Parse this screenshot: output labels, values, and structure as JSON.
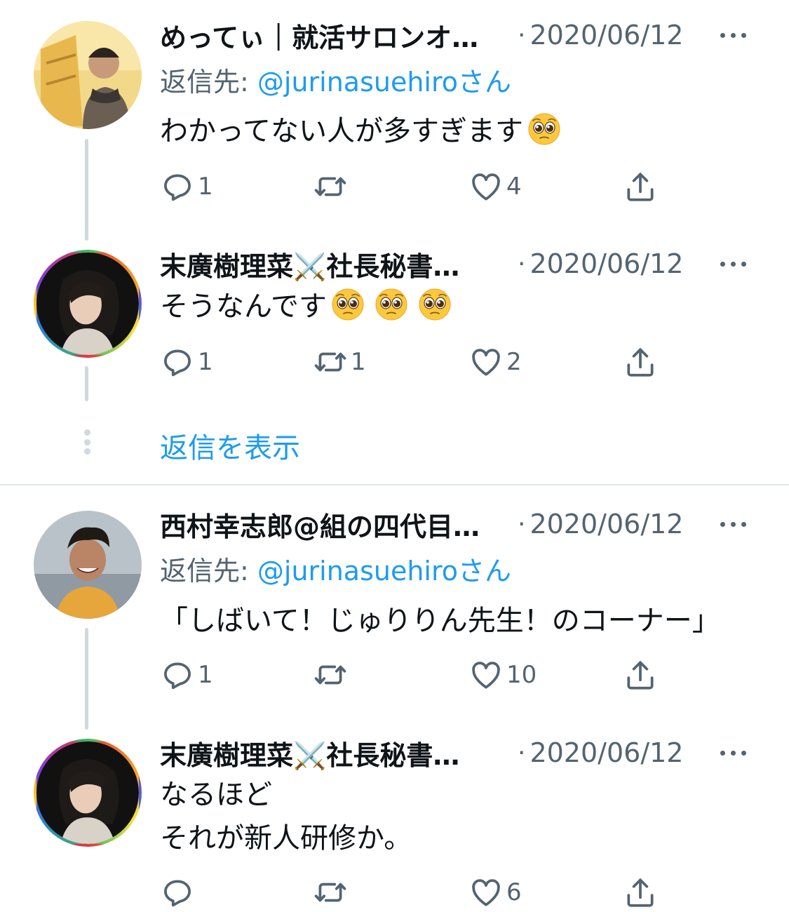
{
  "tweets": [
    {
      "name": "めってぃ｜就活サロンオ…",
      "separator": "·",
      "date": "2020/06/12",
      "reply_prefix": "返信先: ",
      "reply_handle": "@jurinasuehiro",
      "reply_suffix": "さん",
      "text_lines": [
        "わかってない人が多すぎます"
      ],
      "emoji_count": 1,
      "replies": "1",
      "retweets": "",
      "likes": "4"
    },
    {
      "name": "末廣樹理菜⚔️社長秘書…",
      "separator": "·",
      "date": "2020/06/12",
      "text_lines": [
        "そうなんです"
      ],
      "emoji_count": 3,
      "replies": "1",
      "retweets": "1",
      "likes": "2"
    },
    {
      "name": "西村幸志郎@組の四代目…",
      "separator": "·",
      "date": "2020/06/12",
      "reply_prefix": "返信先: ",
      "reply_handle": "@jurinasuehiro",
      "reply_suffix": "さん",
      "text_lines": [
        "「しばいて！じゅりりん先生！のコーナー」"
      ],
      "replies": "1",
      "retweets": "",
      "likes": "10"
    },
    {
      "name": "末廣樹理菜⚔️社長秘書…",
      "separator": "·",
      "date": "2020/06/12",
      "text_lines": [
        "なるほど",
        "それが新人研修か。"
      ],
      "replies": "",
      "retweets": "",
      "likes": "6"
    }
  ],
  "show_replies_label": "返信を表示",
  "icons": {
    "reply": "reply-icon",
    "retweet": "retweet-icon",
    "like": "heart-icon",
    "share": "share-icon",
    "more": "more-icon",
    "emoji": "pleading-face-emoji"
  },
  "colors": {
    "link": "#1d9bf0",
    "muted": "#536471",
    "thread_line": "#cfd9de"
  }
}
